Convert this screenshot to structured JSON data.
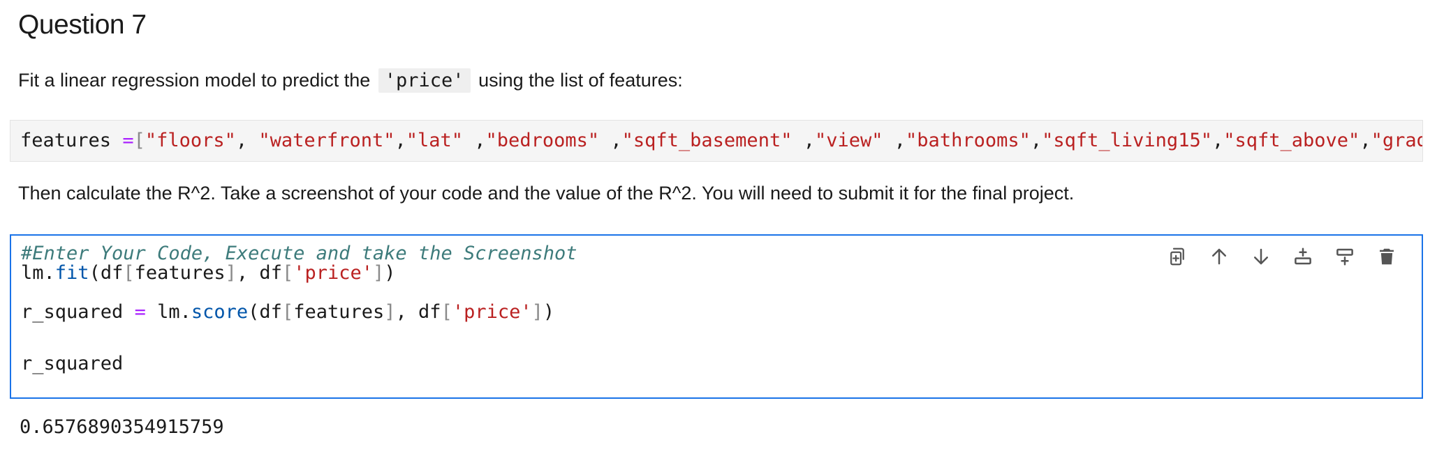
{
  "heading": "Question 7",
  "instructions": {
    "line1_prefix": "Fit a linear regression model to predict the",
    "line1_code": "'price'",
    "line1_suffix": "using the list of features:",
    "line2": "Then calculate the R^2. Take a screenshot of your code and the value of the R^2. You will need to submit it for the final project."
  },
  "features_block": {
    "var": "features",
    "op": "=",
    "open": "[",
    "items": [
      "\"floors\"",
      "\"waterfront\"",
      "\"lat\"",
      "\"bedrooms\"",
      "\"sqft_basement\"",
      "\"view\"",
      "\"bathrooms\"",
      "\"sqft_living15\"",
      "\"sqft_above\"",
      "\"grade\"",
      "\""
    ],
    "separators": [
      ", ",
      ",",
      " ,",
      " ,",
      " ,",
      " ,",
      ",",
      ",",
      ",",
      ","
    ]
  },
  "code_cell": {
    "comment": "#Enter Your Code, Execute and take the Screenshot",
    "line2": {
      "obj": "lm",
      "dot": ".",
      "fn": "fit",
      "p1": "(df",
      "b1": "[",
      "arg": "features",
      "b2": "]",
      "mid": ", df",
      "b3": "[",
      "str": "'price'",
      "b4": "]",
      "end": ")"
    },
    "line3": {
      "var": "r_squared",
      "eq": "=",
      "obj": "lm",
      "dot": ".",
      "fn": "score",
      "p1": "(df",
      "b1": "[",
      "arg": "features",
      "b2": "]",
      "mid": ", df",
      "b3": "[",
      "str": "'price'",
      "b4": "]",
      "end": ")"
    },
    "line4": "r_squared"
  },
  "toolbar": {
    "icons": [
      "duplicate-cell-icon",
      "move-up-icon",
      "move-down-icon",
      "insert-above-icon",
      "insert-below-icon",
      "delete-icon"
    ]
  },
  "output_value": "0.6576890354915759",
  "colors": {
    "string": "#ba2121",
    "operator": "#aa22ff",
    "comment": "#3d7b7b",
    "function": "#0055aa",
    "cell_border": "#1a73e8"
  }
}
